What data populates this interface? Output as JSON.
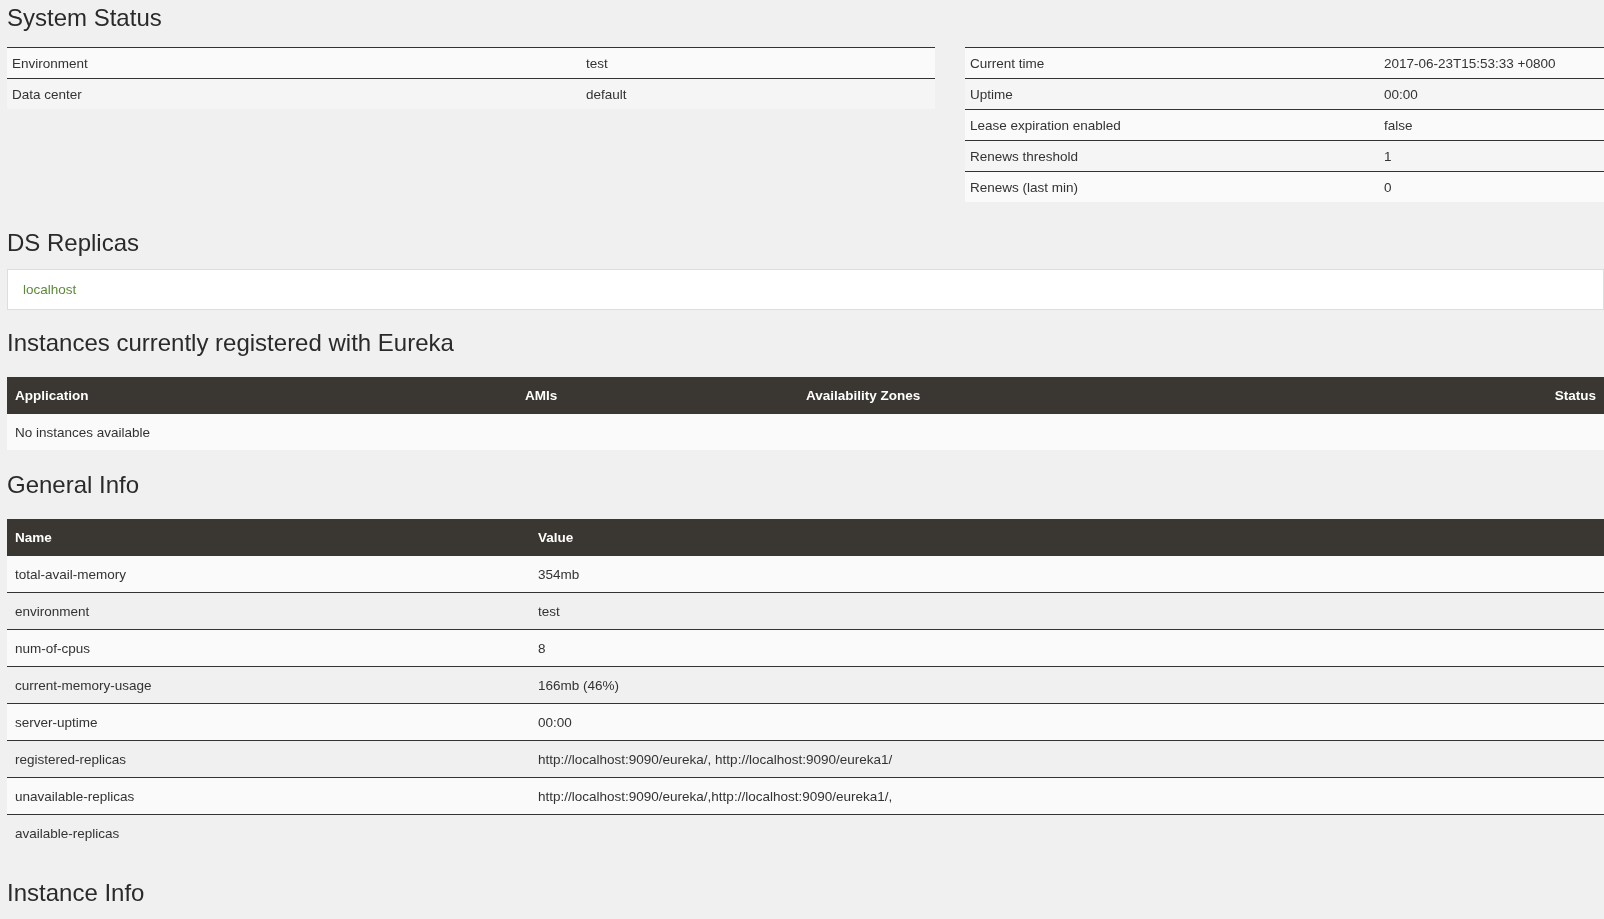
{
  "system_status": {
    "title": "System Status",
    "left_table": [
      {
        "label": "Environment",
        "value": "test"
      },
      {
        "label": "Data center",
        "value": "default"
      }
    ],
    "right_table": [
      {
        "label": "Current time",
        "value": "2017-06-23T15:53:33 +0800"
      },
      {
        "label": "Uptime",
        "value": "00:00"
      },
      {
        "label": "Lease expiration enabled",
        "value": "false"
      },
      {
        "label": "Renews threshold",
        "value": "1"
      },
      {
        "label": "Renews (last min)",
        "value": "0"
      }
    ]
  },
  "ds_replicas": {
    "title": "DS Replicas",
    "replicas": [
      "localhost"
    ]
  },
  "instances": {
    "title": "Instances currently registered with Eureka",
    "columns": [
      "Application",
      "AMIs",
      "Availability Zones",
      "Status"
    ],
    "empty_message": "No instances available"
  },
  "general_info": {
    "title": "General Info",
    "columns": [
      "Name",
      "Value"
    ],
    "rows": [
      {
        "name": "total-avail-memory",
        "value": "354mb"
      },
      {
        "name": "environment",
        "value": "test"
      },
      {
        "name": "num-of-cpus",
        "value": "8"
      },
      {
        "name": "current-memory-usage",
        "value": "166mb (46%)"
      },
      {
        "name": "server-uptime",
        "value": "00:00"
      },
      {
        "name": "registered-replicas",
        "value": "http://localhost:9090/eureka/, http://localhost:9090/eureka1/"
      },
      {
        "name": "unavailable-replicas",
        "value": "http://localhost:9090/eureka/,http://localhost:9090/eureka1/,"
      },
      {
        "name": "available-replicas"
      }
    ]
  },
  "instance_info": {
    "title": "Instance Info"
  }
}
